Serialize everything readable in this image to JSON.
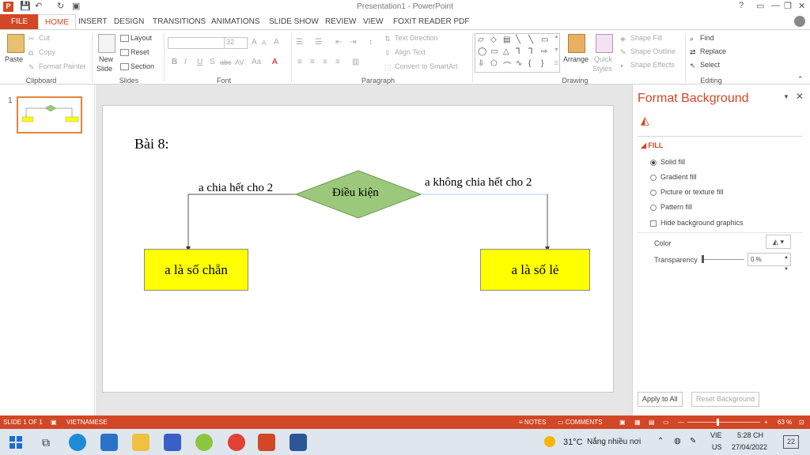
{
  "window": {
    "title": "Presentation1 - PowerPoint",
    "app_logo": "P",
    "qat_icons": [
      "save-icon",
      "undo-icon",
      "redo-icon",
      "present-icon"
    ],
    "window_buttons": [
      "?",
      "▭",
      "—",
      "❐",
      "✕"
    ]
  },
  "tabs": [
    "FILE",
    "HOME",
    "INSERT",
    "DESIGN",
    "TRANSITIONS",
    "ANIMATIONS",
    "SLIDE SHOW",
    "REVIEW",
    "VIEW",
    "FOXIT READER PDF"
  ],
  "ribbon": {
    "clipboard": {
      "paste": "Paste",
      "cut": "Cut",
      "copy": "Copy",
      "format_painter": "Format Painter",
      "label": "Clipboard"
    },
    "slides": {
      "new_slide_1": "New",
      "new_slide_2": "Slide",
      "layout": "Layout",
      "reset": "Reset",
      "section": "Section",
      "label": "Slides"
    },
    "font": {
      "size": "32",
      "label": "Font",
      "bold": "B",
      "italic": "I",
      "underline": "U",
      "strike": "S",
      "abc": "abc",
      "av": "AV",
      "aa": "Aa",
      "grow": "A",
      "shrink": "A",
      "clear": "A"
    },
    "paragraph": {
      "text_direction": "Text Direction",
      "align_text": "Align Text",
      "convert": "Convert to SmartArt",
      "label": "Paragraph"
    },
    "drawing": {
      "arrange": "Arrange",
      "quick_styles_1": "Quick",
      "quick_styles_2": "Styles",
      "shape_fill": "Shape Fill",
      "shape_outline": "Shape Outline",
      "shape_effects": "Shape Effects",
      "label": "Drawing"
    },
    "editing": {
      "find": "Find",
      "replace": "Replace",
      "select": "Select",
      "label": "Editing"
    }
  },
  "thumbnail": {
    "number": "1"
  },
  "slide": {
    "title": "Bài 8:",
    "condition": "Điều kiện",
    "left_label": "a chia hết cho 2",
    "right_label": "a không chia hết cho 2",
    "left_box": "a là số chẵn",
    "right_box": "a là số lẻ",
    "colors": {
      "diamond_fill": "#9bc87a",
      "diamond_stroke": "#6b9a52",
      "box_fill": "#ffff00"
    }
  },
  "format_pane": {
    "title": "Format Background",
    "section": "FILL",
    "options": [
      {
        "label": "Solid fill",
        "checked": true
      },
      {
        "label": "Gradient fill",
        "checked": false
      },
      {
        "label": "Picture or texture fill",
        "checked": false
      },
      {
        "label": "Pattern fill",
        "checked": false
      }
    ],
    "hide_graphics": "Hide background graphics",
    "color_label": "Color",
    "transparency_label": "Transparency",
    "transparency_value": "0 %",
    "apply_all": "Apply to All",
    "reset_bg": "Reset Background"
  },
  "statusbar": {
    "slide_info": "SLIDE 1 OF 1",
    "language": "VIETNAMESE",
    "notes": "NOTES",
    "comments": "COMMENTS",
    "zoom": "63 %",
    "accent": "#d24726"
  },
  "taskbar": {
    "weather_temp": "31°C",
    "weather_text": "Nắng nhiều nơi",
    "lang_1": "VIE",
    "lang_2": "US",
    "time": "5:28 CH",
    "date": "27/04/2022",
    "notifications": "22"
  }
}
